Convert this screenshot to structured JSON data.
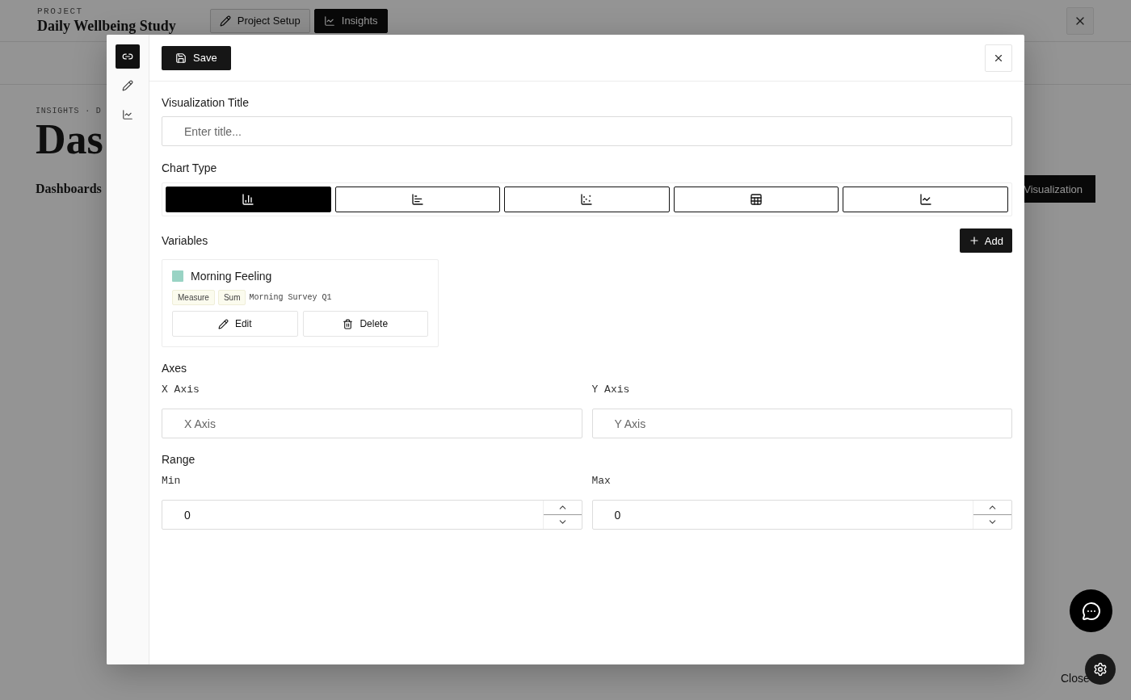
{
  "background": {
    "project_label": "PROJECT",
    "project_name": "Daily Wellbeing Study",
    "nav": [
      {
        "label": "Project Setup",
        "kind": "setup",
        "selected": false
      },
      {
        "label": "Insights",
        "kind": "insights",
        "selected": true
      }
    ],
    "breadcrumb": "INSIGHTS · D",
    "heading": "Das",
    "tab": "Dashboards",
    "new_button": "Visualization",
    "close_link": "Close"
  },
  "modal": {
    "sidebar": [
      {
        "kind": "link",
        "selected": true
      },
      {
        "kind": "edit",
        "selected": false
      },
      {
        "kind": "chart",
        "selected": false
      }
    ],
    "save_button": "Save",
    "title_label": "Visualization Title",
    "title_placeholder": "Enter title...",
    "chart_type_label": "Chart Type",
    "chart_types": [
      {
        "kind": "bar",
        "selected": true
      },
      {
        "kind": "hbar",
        "selected": false
      },
      {
        "kind": "scatter",
        "selected": false
      },
      {
        "kind": "table",
        "selected": false
      },
      {
        "kind": "line",
        "selected": false
      }
    ],
    "variables_label": "Variables",
    "add_button": "Add",
    "variables": [
      {
        "name": "Morning Feeling",
        "color": "#99d3c4",
        "tags": [
          "Measure",
          "Sum"
        ],
        "source": "Morning Survey Q1",
        "edit": "Edit",
        "delete": "Delete"
      }
    ],
    "axes_label": "Axes",
    "axes": [
      {
        "label": "X Axis",
        "placeholder": "X Axis"
      },
      {
        "label": "Y Axis",
        "placeholder": "Y Axis"
      }
    ],
    "range_label": "Range",
    "range": [
      {
        "label": "Min",
        "value": "0"
      },
      {
        "label": "Max",
        "value": "0"
      }
    ]
  }
}
